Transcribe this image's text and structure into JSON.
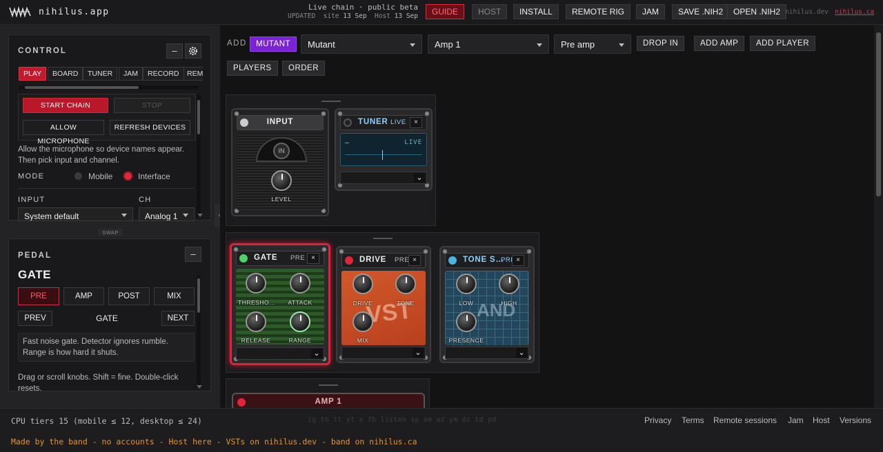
{
  "topbar": {
    "brand": "nihilus.app",
    "status_line": "Live chain · public beta",
    "updated_label": "UPDATED",
    "site_label": "site",
    "site_date": "13 Sep",
    "host_label": "Host",
    "host_date": "13 Sep",
    "buttons": [
      "GUIDE",
      "HOST",
      "INSTALL",
      "REMOTE RIG",
      "JAM",
      "SAVE .NIH2",
      "OPEN .NIH2"
    ],
    "link_dev": "nihilus.dev",
    "link_ca": "nihilus.ca"
  },
  "control": {
    "title": "CONTROL",
    "minimize_label": "–",
    "tabs": [
      "PLAY",
      "BOARD",
      "TUNER",
      "JAM",
      "RECORD",
      "REM"
    ],
    "active_tab": "PLAY",
    "start_chain": "START CHAIN",
    "stop": "STOP",
    "allow_microphone": "ALLOW MICROPHONE",
    "refresh_devices": "REFRESH DEVICES",
    "help": "Allow the microphone so device names appear. Then pick input and channel.",
    "mode_label": "MODE",
    "mode_options": [
      "Mobile",
      "Interface"
    ],
    "mode_selected": "Interface",
    "input_label": "INPUT",
    "ch_label": "CH",
    "input_value": "System default",
    "ch_value": "Analog 1",
    "swap_label": "SWAP"
  },
  "pedal_panel": {
    "title": "PEDAL",
    "minimize_label": "–",
    "pedal_name": "GATE",
    "segments": [
      "PRE",
      "AMP",
      "POST",
      "MIX"
    ],
    "active_segment": "PRE",
    "prev_label": "PREV",
    "next_label": "NEXT",
    "current": "GATE",
    "description": "Fast noise gate. Detector ignores rumble. Range is how hard it shuts.",
    "hint": "Drag or scroll knobs. Shift = fine. Double-click resets."
  },
  "toolbar": {
    "add_label": "ADD",
    "mutant_button": "MUTANT",
    "type_select": "Mutant",
    "amp_select": "Amp 1",
    "stage_select": "Pre amp",
    "drop_in": "DROP IN",
    "add_amp": "ADD AMP",
    "add_player": "ADD PLAYER",
    "players": "PLAYERS",
    "order": "ORDER"
  },
  "input_rack": {
    "input_pedal": {
      "name": "INPUT",
      "badge": "IN",
      "knob": "LEVEL"
    },
    "tuner_pedal": {
      "name": "TUNER",
      "tag": "LIVE",
      "close": "×",
      "note": "–",
      "screen_live": "LIVE"
    }
  },
  "pre_rack": {
    "pedals": [
      {
        "name": "GATE",
        "tag": "PRE",
        "close": "×",
        "led": "#4fd06a",
        "knobs": [
          "THRESHO…",
          "ATTACK",
          "RELEASE",
          "RANGE"
        ],
        "selected": true
      },
      {
        "name": "DRIVE",
        "tag": "PRE",
        "close": "×",
        "led": "#e0273a",
        "knobs": [
          "DRIVE",
          "TONE",
          "MIX"
        ],
        "art_text": "VST"
      },
      {
        "name": "TONE S…",
        "tag": "PRE",
        "close": "×",
        "led": "#4ab6e0",
        "knobs": [
          "LOW",
          "HIGH",
          "PRESENCE"
        ],
        "art_text": "AND"
      }
    ]
  },
  "amp_rack": {
    "name": "AMP 1"
  },
  "footer": {
    "cpu": "CPU tiers 15 (mobile ≤ 12, desktop ≤ 24)",
    "shortcuts": "ig th tt yt x fb   listen sp am az ym dz td pd",
    "links": [
      "Privacy",
      "Terms",
      "Remote sessions",
      "Jam",
      "Host",
      "Versions"
    ],
    "tagline": "Made by the band - no accounts - Host here - VSTs on nihilus.dev - band on nihilus.ca"
  },
  "colors": {
    "accent_red": "#e0233a",
    "purple": "#7a22d6",
    "tagline_orange": "#e8922e"
  }
}
